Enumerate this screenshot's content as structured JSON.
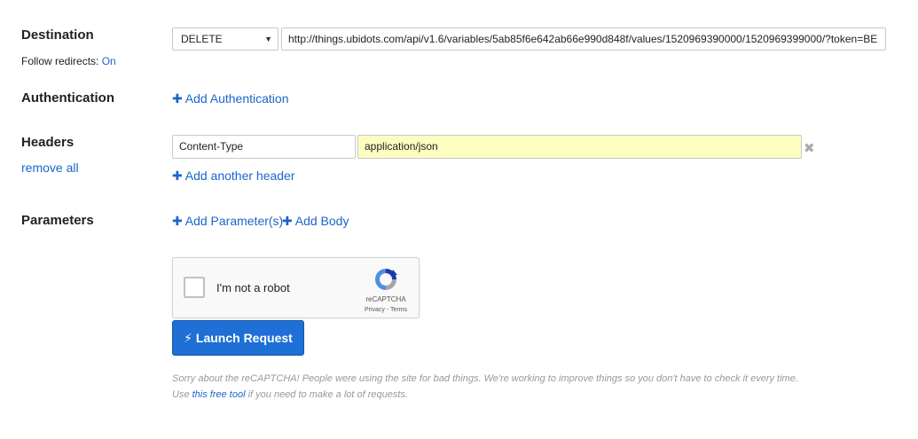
{
  "destination": {
    "label": "Destination",
    "follow_redirects_label": "Follow redirects:",
    "follow_redirects_value": "On",
    "method": "DELETE",
    "method_caret": "▼",
    "url": "http://things.ubidots.com/api/v1.6/variables/5ab85f6e642ab66e990d848f/values/1520969390000/1520969399000/?token=BE"
  },
  "authentication": {
    "label": "Authentication",
    "plus": "✚",
    "add_label": "Add Authentication"
  },
  "headers": {
    "label": "Headers",
    "remove_all": "remove all",
    "items": [
      {
        "name": "Content-Type",
        "value": "application/json",
        "remove": "✖"
      }
    ],
    "plus": "✚",
    "add_label": "Add another header"
  },
  "parameters": {
    "label": "Parameters",
    "plus": "✚",
    "add_params_label": "Add Parameter(s)",
    "add_body_label": "Add Body"
  },
  "captcha": {
    "label": "I'm not a robot",
    "brand": "reCAPTCHA",
    "terms": "Privacy - Terms"
  },
  "launch": {
    "icon": "⚡",
    "label": "Launch Request"
  },
  "notes": {
    "line1": "Sorry about the reCAPTCHA! People were using the site for bad things. We're working to improve things so you don't have to check it every time.",
    "line2_prefix": "Use",
    "line2_link": "this free tool",
    "line2_suffix": "if you need to make a lot of requests."
  },
  "colors": {
    "link": "#1a66c9",
    "button": "#1e6fd6",
    "highlight_input": "#fdfdc0"
  }
}
